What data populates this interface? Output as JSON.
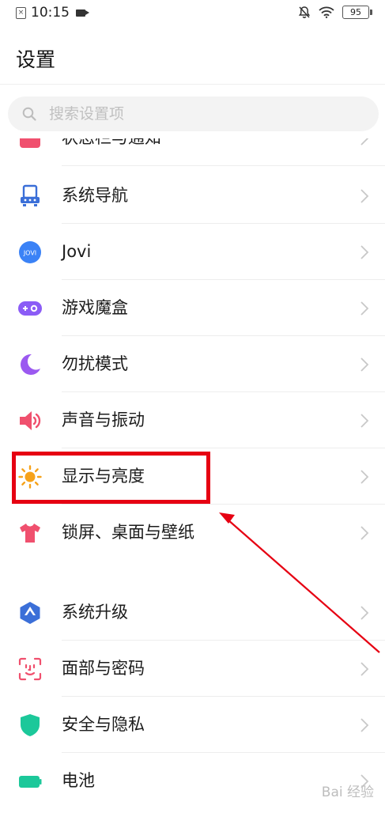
{
  "status_bar": {
    "time": "10:15",
    "battery": "95"
  },
  "page": {
    "title": "设置"
  },
  "search": {
    "placeholder": "搜索设置项"
  },
  "items": [
    {
      "label": "状态栏与通知",
      "icon": "notification-icon",
      "color": "#f0506e"
    },
    {
      "label": "系统导航",
      "icon": "navigation-icon",
      "color": "#3b6fd8"
    },
    {
      "label": "Jovi",
      "icon": "jovi-icon",
      "icon_text": "JOVI",
      "color": "#3b82f6"
    },
    {
      "label": "游戏魔盒",
      "icon": "game-box-icon",
      "color": "#8b5cf6"
    },
    {
      "label": "勿扰模式",
      "icon": "moon-icon",
      "color": "#9b59f0"
    },
    {
      "label": "声音与振动",
      "icon": "speaker-icon",
      "color": "#f0506e"
    },
    {
      "label": "显示与亮度",
      "icon": "sun-icon",
      "color": "#f6a21a"
    },
    {
      "label": "锁屏、桌面与壁纸",
      "icon": "shirt-icon",
      "color": "#f0506e"
    },
    {
      "label": "系统升级",
      "icon": "upgrade-icon",
      "color": "#3b6fd8"
    },
    {
      "label": "面部与密码",
      "icon": "face-id-icon",
      "color": "#f0506e"
    },
    {
      "label": "安全与隐私",
      "icon": "shield-icon",
      "color": "#1cc89a"
    },
    {
      "label": "电池",
      "icon": "battery-icon",
      "color": "#1cc89a"
    }
  ],
  "annotation": {
    "highlight_color": "#e60012"
  },
  "watermark": "Bai 经验"
}
